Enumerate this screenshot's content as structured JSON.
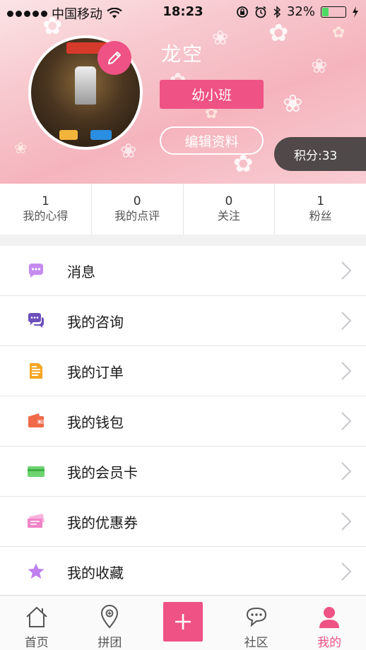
{
  "status_bar": {
    "carrier": "中国移动",
    "time": "18:23",
    "battery_percent": "32%",
    "battery_level": 0.32
  },
  "profile": {
    "username": "龙空",
    "class_badge": "幼小班",
    "edit_profile_label": "编辑资料",
    "points_label": "积分:33"
  },
  "stats": [
    {
      "value": "1",
      "label": "我的心得"
    },
    {
      "value": "0",
      "label": "我的点评"
    },
    {
      "value": "0",
      "label": "关注"
    },
    {
      "value": "1",
      "label": "粉丝"
    }
  ],
  "menu": [
    {
      "label": "消息",
      "icon": "message-icon",
      "color": "#c58af0"
    },
    {
      "label": "我的咨询",
      "icon": "consult-chat-icon",
      "color": "#6b4fbb"
    },
    {
      "label": "我的订单",
      "icon": "order-document-icon",
      "color": "#f5a623"
    },
    {
      "label": "我的钱包",
      "icon": "wallet-icon",
      "color": "#f06a4a"
    },
    {
      "label": "我的会员卡",
      "icon": "member-card-icon",
      "color": "#6dd36f"
    },
    {
      "label": "我的优惠券",
      "icon": "coupon-icon",
      "color": "#f084c8"
    },
    {
      "label": "我的收藏",
      "icon": "star-icon",
      "color": "#c07ff0"
    }
  ],
  "tabbar": [
    {
      "label": "首页",
      "icon": "home-icon"
    },
    {
      "label": "拼团",
      "icon": "location-pin-icon"
    },
    {
      "label": "",
      "icon": "plus-icon"
    },
    {
      "label": "社区",
      "icon": "community-chat-icon"
    },
    {
      "label": "我的",
      "icon": "user-icon",
      "active": true
    }
  ],
  "colors": {
    "accent": "#ef5285"
  }
}
